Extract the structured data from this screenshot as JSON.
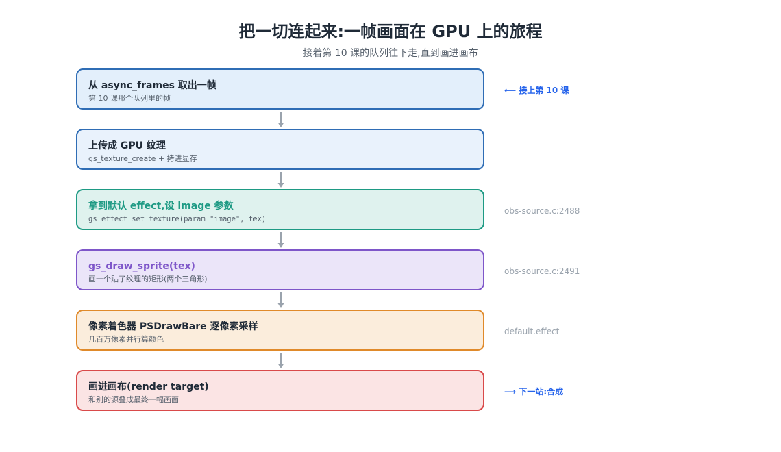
{
  "header": {
    "title": "把一切连起来:一帧画面在 GPU 上的旅程",
    "subtitle": "接着第 10 课的队列往下走,直到画进画布"
  },
  "steps": [
    {
      "title": "从 async_frames 取出一帧",
      "desc": "第 10 课那个队列里的帧",
      "note": "⟵ 接上第 10 课",
      "fill": "#e3effb",
      "border": "#2f6db5",
      "title_color": "#1f2a37"
    },
    {
      "title": "上传成 GPU 纹理",
      "desc": "gs_texture_create + 拷进显存",
      "note": "",
      "fill": "#e9f2fc",
      "border": "#2f6db5",
      "title_color": "#1f2a37"
    },
    {
      "title": "拿到默认 effect,设 image 参数",
      "desc": "gs_effect_set_texture(param \"image\", tex)",
      "note": "obs-source.c:2488",
      "fill": "#dff2ee",
      "border": "#1e9a84",
      "title_color": "#1e9a84"
    },
    {
      "title": "gs_draw_sprite(tex)",
      "desc": "画一个贴了纹理的矩形(两个三角形)",
      "note": "obs-source.c:2491",
      "fill": "#ebe5f9",
      "border": "#7e56c9",
      "title_color": "#7e56c9"
    },
    {
      "title": "像素着色器 PSDrawBare 逐像素采样",
      "desc": "几百万像素并行算颜色",
      "note": "default.effect",
      "fill": "#fbeddc",
      "border": "#e08a2a",
      "title_color": "#1f2a37"
    },
    {
      "title": "画进画布(render target)",
      "desc": "和别的源叠成最终一幅画面",
      "note": "⟶ 下一站:合成",
      "fill": "#fbe4e4",
      "border": "#d94a4a",
      "title_color": "#1f2a37"
    }
  ],
  "colors": {
    "arrow": "#9aa3ad",
    "link_note": "#2563eb",
    "muted_note": "#9aa3ad"
  }
}
